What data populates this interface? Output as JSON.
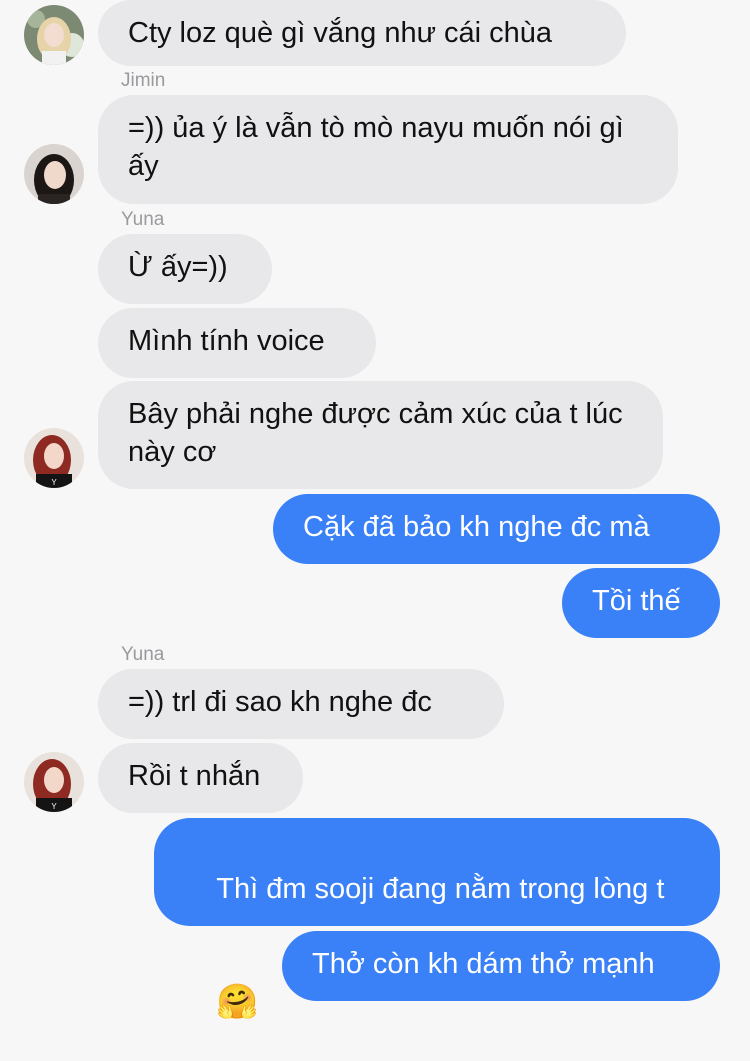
{
  "messages": [
    {
      "side": "in",
      "text": "Cty loz què gì vắng như cái chùa"
    },
    {
      "side": "in",
      "text": "=)) ủa ý là vẫn tò mò nayu muốn nói gì ấy"
    },
    {
      "side": "in",
      "text": "Ừ ấy=))"
    },
    {
      "side": "in",
      "text": "Mình tính voice"
    },
    {
      "side": "in",
      "text": "Bây phải nghe được cảm xúc của t lúc này cơ"
    },
    {
      "side": "out",
      "text": "Cặk đã bảo kh nghe đc mà"
    },
    {
      "side": "out",
      "text": "Tồi thế"
    },
    {
      "side": "in",
      "text": "=)) trl đi sao kh nghe đc"
    },
    {
      "side": "in",
      "text": "Rồi t nhắn"
    },
    {
      "side": "out",
      "text": "Thì đm sooji đang nằm trong lòng t",
      "emoji": "🤗"
    },
    {
      "side": "out",
      "text": "Thở còn kh dám thở mạnh"
    }
  ],
  "senders": {
    "jimin": "Jimin",
    "yuna_1": "Yuna",
    "yuna_2": "Yuna"
  },
  "avatars": {
    "user_1": "blonde-girl-avatar",
    "user_2": "dark-hair-girl-avatar",
    "user_3": "red-hair-girl-avatar",
    "user_4": "red-hair-girl-avatar"
  },
  "colors": {
    "background": "#f7f7f7",
    "incoming_bubble": "#e8e8ea",
    "outgoing_bubble": "#3a80f6",
    "sender_name": "#9a9a9e"
  }
}
